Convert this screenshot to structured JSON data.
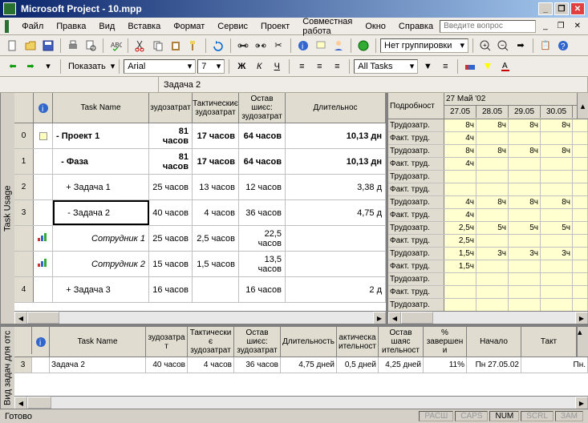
{
  "app": {
    "title": "Microsoft Project - 10.mpp",
    "question_prompt": "Введите вопрос"
  },
  "menus": [
    "Файл",
    "Правка",
    "Вид",
    "Вставка",
    "Формат",
    "Сервис",
    "Проект",
    "Совместная работа",
    "Окно",
    "Справка"
  ],
  "toolbar": {
    "show_label": "Показать",
    "font": "Arial",
    "size": "7",
    "filter": "All Tasks",
    "group": "Нет группировки"
  },
  "formula": {
    "cell_value": "Задача 2"
  },
  "left_headers": [
    "Task Name",
    "зудозатрат",
    "Тактическиє зудозатрат",
    "Остав шиєс: зудозатрат",
    "Длительнос"
  ],
  "tasks": [
    {
      "id": "0",
      "name": "- Проект 1",
      "work": "81 часов",
      "actual": "17 часов",
      "remain": "64 часов",
      "dur": "10,13 дн",
      "bold": true
    },
    {
      "id": "1",
      "name": "  - Фаза",
      "work": "81 часов",
      "actual": "17 часов",
      "remain": "64 часов",
      "dur": "10,13 дн",
      "bold": true
    },
    {
      "id": "2",
      "name": "    + Задача 1",
      "work": "25 часов",
      "actual": "13 часов",
      "remain": "12 часов",
      "dur": "3,38 д"
    },
    {
      "id": "3",
      "name": "    - Задача 2",
      "work": "40 часов",
      "actual": "4 часов",
      "remain": "36 часов",
      "dur": "4,75 д",
      "selected": true
    },
    {
      "id": "",
      "name": "        Сотрудник 1",
      "work": "25 часов",
      "actual": "2,5 часов",
      "remain": "22,5 часов",
      "dur": "",
      "italic": true,
      "icon": "res"
    },
    {
      "id": "",
      "name": "        Сотрудник 2",
      "work": "15 часов",
      "actual": "1,5 часов",
      "remain": "13,5 часов",
      "dur": "",
      "italic": true,
      "icon": "res"
    },
    {
      "id": "4",
      "name": "    + Задача 3",
      "work": "16 часов",
      "actual": "",
      "remain": "16 часов",
      "dur": "2 д"
    }
  ],
  "right": {
    "detail_label": "Подробност",
    "date_header": "27 Май '02",
    "dates": [
      "27.05",
      "28.05",
      "29.05",
      "30.05"
    ],
    "labels": {
      "work": "Трудозатр.",
      "actual": "Факт. труд."
    },
    "rows": [
      {
        "label": "Трудозатр.",
        "cells": [
          "8ч",
          "8ч",
          "8ч",
          "8ч"
        ]
      },
      {
        "label": "Факт. труд.",
        "cells": [
          "4ч",
          "",
          "",
          ""
        ]
      },
      {
        "label": "Трудозатр.",
        "cells": [
          "8ч",
          "8ч",
          "8ч",
          "8ч"
        ]
      },
      {
        "label": "Факт. труд.",
        "cells": [
          "4ч",
          "",
          "",
          ""
        ]
      },
      {
        "label": "Трудозатр.",
        "cells": [
          "",
          "",
          "",
          ""
        ]
      },
      {
        "label": "Факт. труд.",
        "cells": [
          "",
          "",
          "",
          ""
        ]
      },
      {
        "label": "Трудозатр.",
        "cells": [
          "4ч",
          "8ч",
          "8ч",
          "8ч"
        ]
      },
      {
        "label": "Факт. труд.",
        "cells": [
          "4ч",
          "",
          "",
          ""
        ]
      },
      {
        "label": "Трудозатр.",
        "cells": [
          "2,5ч",
          "5ч",
          "5ч",
          "5ч"
        ]
      },
      {
        "label": "Факт. труд.",
        "cells": [
          "2,5ч",
          "",
          "",
          ""
        ]
      },
      {
        "label": "Трудозатр.",
        "cells": [
          "1,5ч",
          "3ч",
          "3ч",
          "3ч"
        ]
      },
      {
        "label": "Факт. труд.",
        "cells": [
          "1,5ч",
          "",
          "",
          ""
        ]
      },
      {
        "label": "Трудозатр.",
        "cells": [
          "",
          "",
          "",
          ""
        ]
      },
      {
        "label": "Факт. труд.",
        "cells": [
          "",
          "",
          "",
          ""
        ]
      },
      {
        "label": "Трудозатр.",
        "cells": [
          "",
          "",
          "",
          ""
        ]
      }
    ]
  },
  "bottom": {
    "headers": [
      "",
      "",
      "Task Name",
      "зудозатрат",
      "Тактическиє зудозатрат",
      "Остав шиєс: зудозатрат",
      "Длительность",
      "актическа ительност",
      "Остав шаяс ительност",
      "% завершени",
      "Начало",
      "Такт"
    ],
    "row": {
      "id": "3",
      "name": "Задача 2",
      "work": "40 часов",
      "actual": "4 часов",
      "remain": "36 часов",
      "dur": "4,75 дней",
      "adur": "0,5 дней",
      "rdur": "4,25 дней",
      "pct": "11%",
      "start": "Пн 27.05.02",
      "fact": "Пн."
    }
  },
  "status": {
    "ready": "Готово",
    "indicators": [
      "РАСШ",
      "CAPS",
      "NUM",
      "SCRL",
      "ЗАМ"
    ]
  },
  "vtabs": {
    "top": "Task Usage",
    "bottom": "Вид задач для отс"
  }
}
